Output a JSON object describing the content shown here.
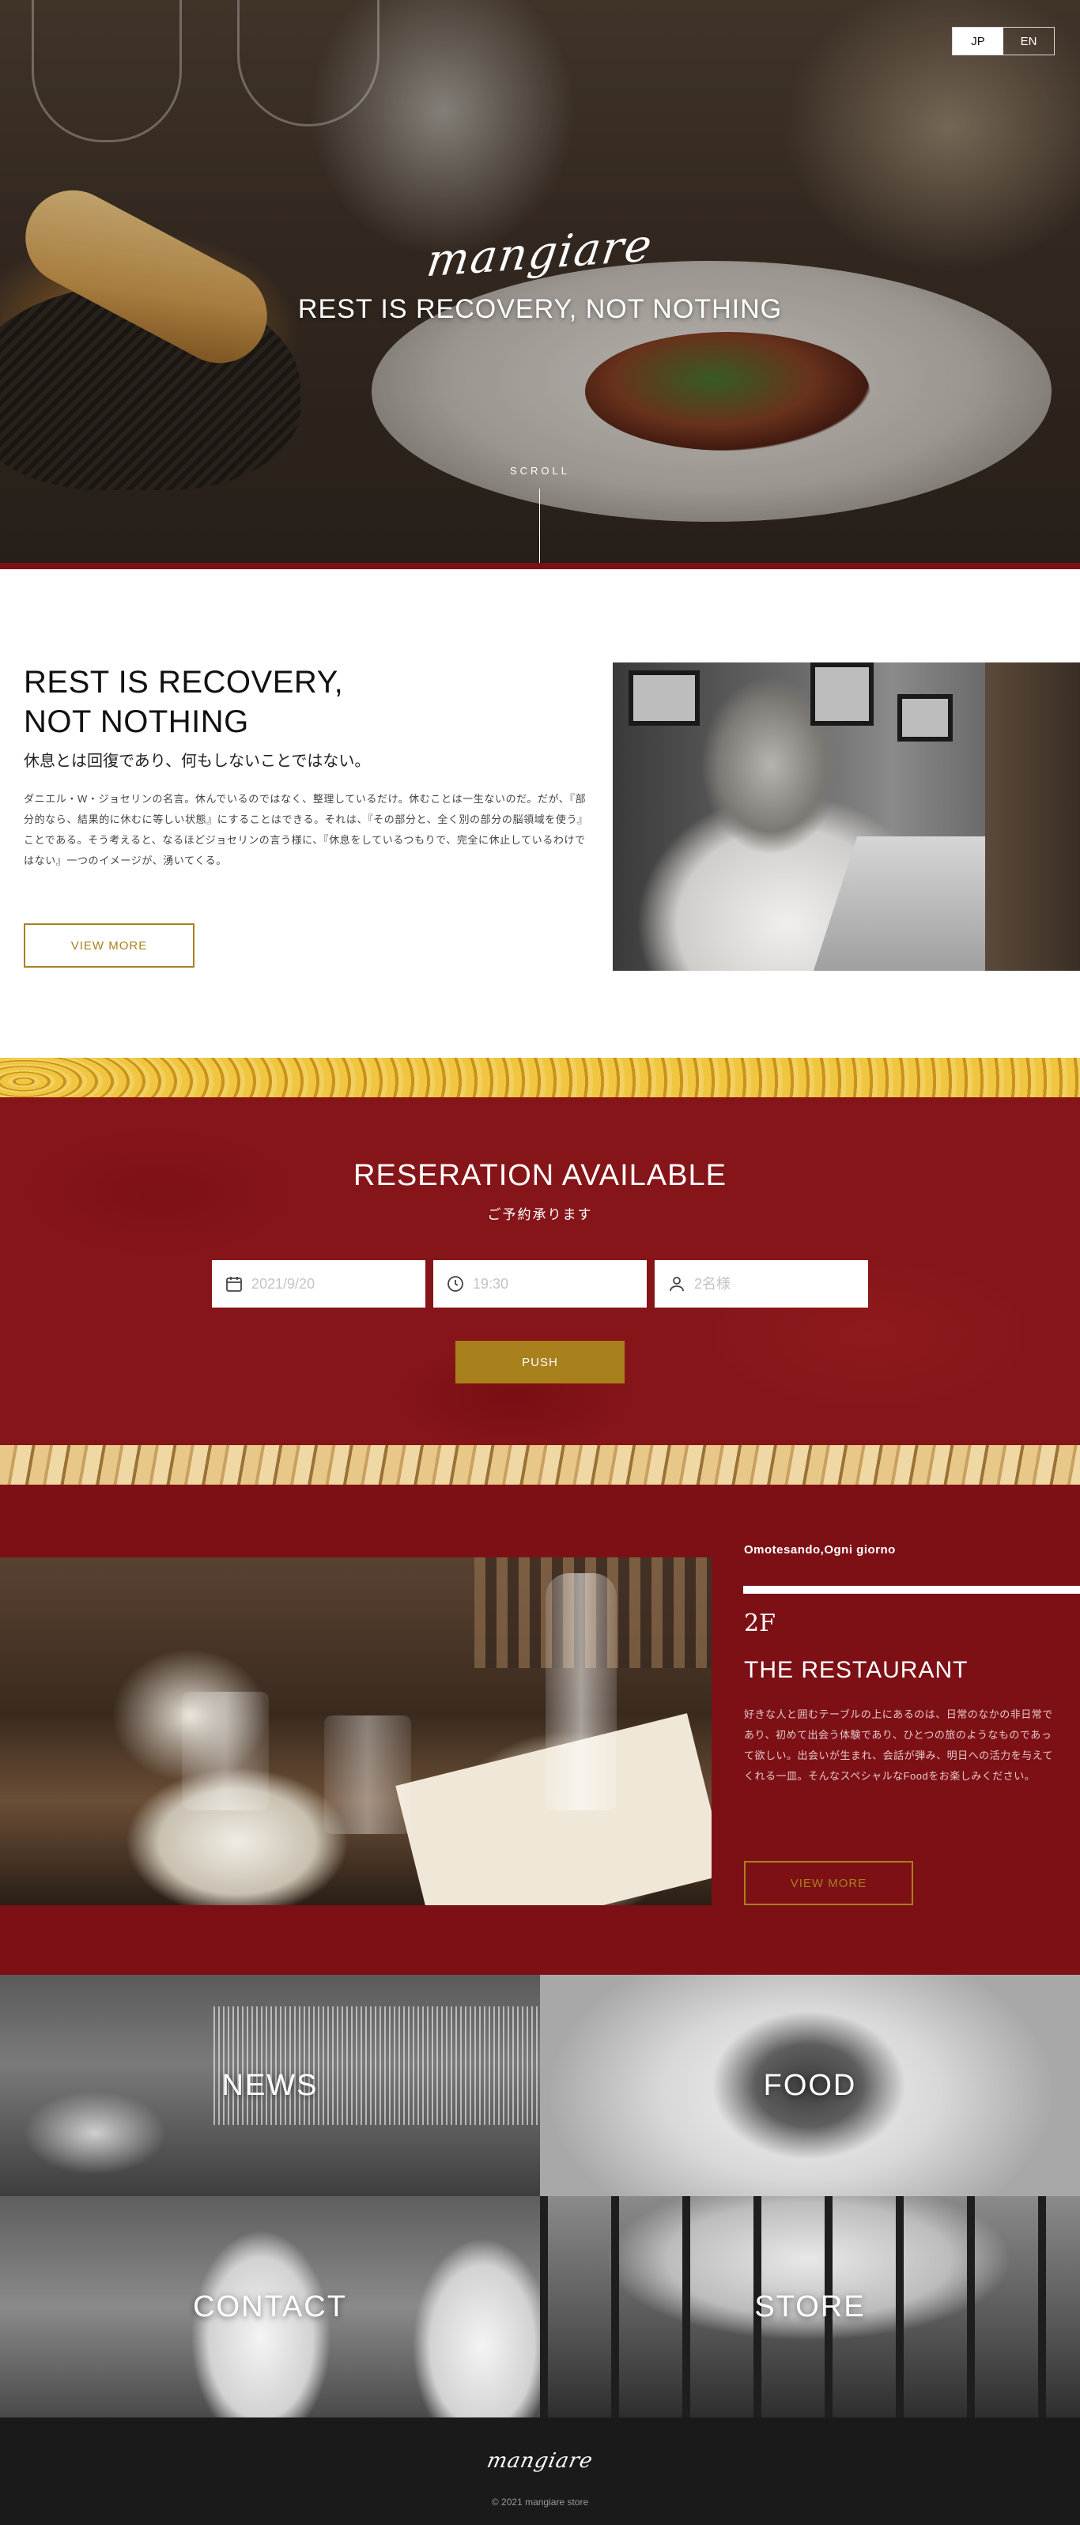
{
  "header": {
    "lang_jp": "JP",
    "lang_en": "EN",
    "active_lang": "JP"
  },
  "hero": {
    "logo": "mangiare",
    "title": "REST IS RECOVERY, NOT NOTHING",
    "scroll": "SCROLL"
  },
  "intro": {
    "heading_line1": "REST IS RECOVERY,",
    "heading_line2": "NOT NOTHING",
    "subheading": "休息とは回復であり、何もしないことではない。",
    "body": "ダニエル・W・ジョセリンの名言。休んでいるのではなく、整理しているだけ。休むことは一生ないのだ。だが、『部分的なら、結果的に休むに等しい状態』にすることはできる。それは、『その部分と、全く別の部分の脳領域を使う』ことである。そう考えると、なるほどジョセリンの言う様に、『休息をしているつもりで、完全に休止しているわけではない』一つのイメージが、湧いてくる。",
    "button": "VIEW MORE"
  },
  "reservation": {
    "title": "RESERATION AVAILABLE",
    "subtitle": "ご予約承ります",
    "date_placeholder": "2021/9/20",
    "time_placeholder": "19:30",
    "people_placeholder": "2名様",
    "button": "PUSH"
  },
  "restaurant": {
    "tag": "Omotesando,Ogni giorno",
    "floor": "2F",
    "name": "THE RESTAURANT",
    "body": "好きな人と囲むテーブルの上にあるのは、日常のなかの非日常であり、初めて出会う体験であり、ひとつの旅のようなものであって欲しい。出会いが生まれ、会話が弾み、明日への活力を与えてくれる一皿。そんなスペシャルなFoodをお楽しみください。",
    "button": "VIEW MORE"
  },
  "tiles": {
    "news": "NEWS",
    "food": "FOOD",
    "contact": "CONTACT",
    "store": "STORE"
  },
  "footer": {
    "logo": "mangiare",
    "copyright": "© 2021 mangiare store"
  },
  "colors": {
    "brand_red": "#7d1015",
    "gold": "#a8801c",
    "footer_bg": "#1a1a1a"
  }
}
